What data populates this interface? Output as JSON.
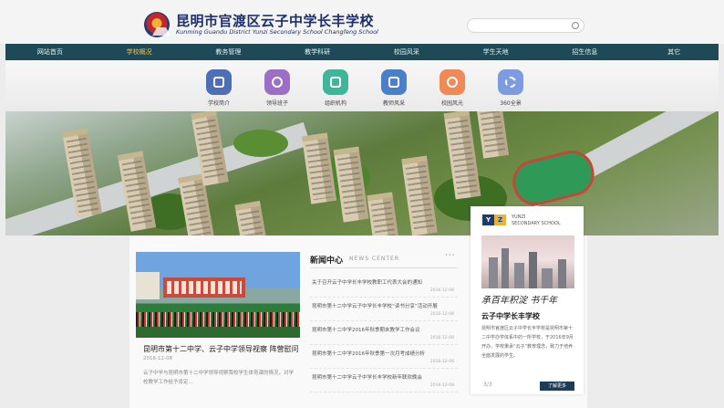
{
  "header": {
    "school_name_cn": "昆明市官渡区云子中学长丰学校",
    "school_name_en": "Kunming Guandu District Yunzi Secondary School Changfeng School",
    "search_placeholder": ""
  },
  "nav": {
    "items": [
      {
        "label": "网站首页"
      },
      {
        "label": "学校概况",
        "active": true
      },
      {
        "label": "教务管理"
      },
      {
        "label": "教学科研"
      },
      {
        "label": "校园风采"
      },
      {
        "label": "学生天地"
      },
      {
        "label": "招生信息"
      },
      {
        "label": "其它"
      }
    ]
  },
  "quick_links": [
    {
      "label": "学校简介",
      "icon": "building-icon",
      "color": "#4e6fb5"
    },
    {
      "label": "领导班子",
      "icon": "people-icon",
      "color": "#9a6fc4"
    },
    {
      "label": "组织机构",
      "icon": "org-chart-icon",
      "color": "#3fb59a"
    },
    {
      "label": "教师风采",
      "icon": "teacher-icon",
      "color": "#4a80c9"
    },
    {
      "label": "校园风光",
      "icon": "campus-icon",
      "color": "#ef8a57"
    },
    {
      "label": "360全景",
      "icon": "panorama-360-icon",
      "color": "#7c9be0"
    }
  ],
  "featured": {
    "title": "昆明市第十二中学、云子中学领导视察 阵营慰问...",
    "date": "2016-12-08",
    "summary": "云子中学与昆明市第十二中学领导视察我校学生体育课的情况，对学校教学工作给予肯定..."
  },
  "news": {
    "heading": "新闻中心",
    "heading_en": "NEWS CENTER",
    "more": "···",
    "items": [
      {
        "title": "关于召开云子中学长丰学校教职工代表大会的通知",
        "date": "2016-12-08"
      },
      {
        "title": "昆明市第十二中学云子中学长丰学校“读书分享”活动开展",
        "date": "2016-12-08"
      },
      {
        "title": "昆明市第十二中学2016年秋季期末教学工作会议",
        "date": "2016-12-08"
      },
      {
        "title": "昆明市第十二中学2016年秋季第一次月考成绩分析",
        "date": "2016-12-08"
      },
      {
        "title": "昆明市第十二中学云子中学长丰学校新年联欢晚会",
        "date": "2016-12-08"
      }
    ]
  },
  "promo": {
    "logo_y": "Y",
    "logo_z": "Z",
    "en_line1": "YUNZI",
    "en_line2": "SECONDARY SCHOOL",
    "slogan": "承百年积淀 书千年",
    "title": "云子中学长丰学校",
    "text": "昆明市官渡区云子中学长丰学校是昆明市第十二中学办学体系中的一所学校，于2016年9月开办。学校秉承“云子”教育理念，致力于培养全面发展的学生。",
    "page_number": "3/3",
    "button": "了解更多"
  }
}
